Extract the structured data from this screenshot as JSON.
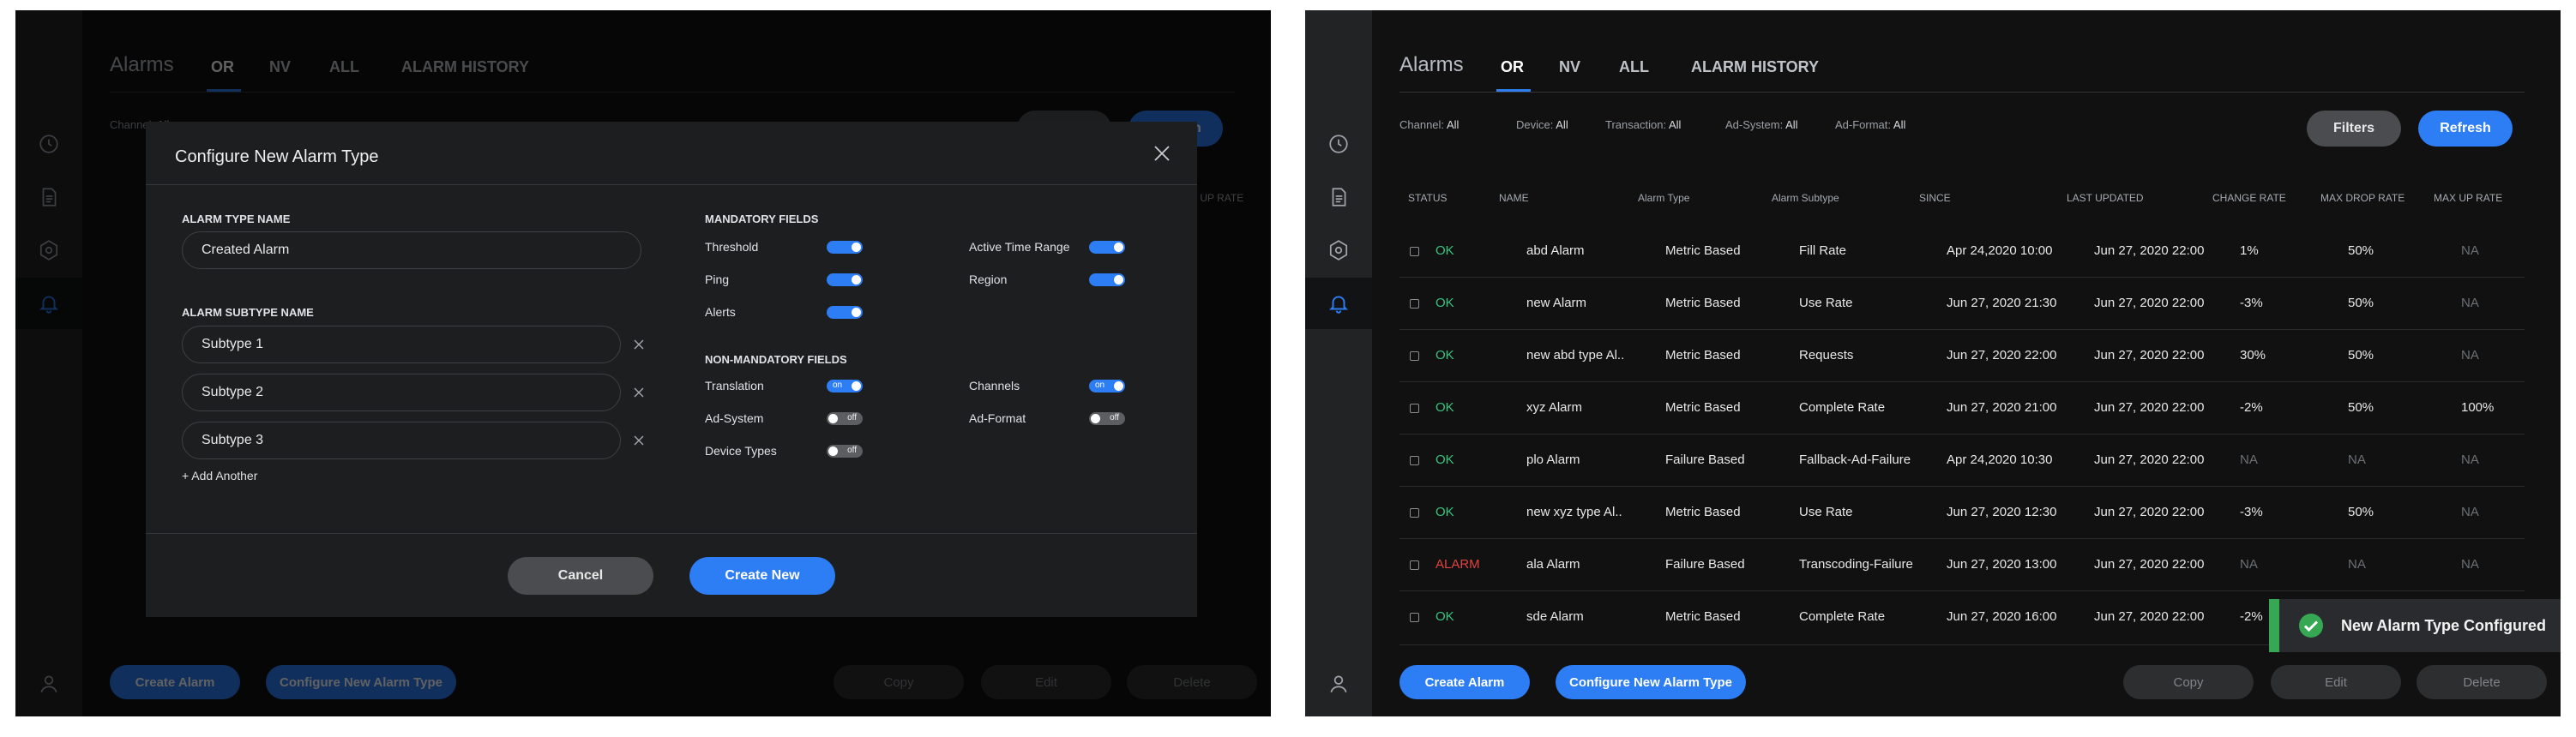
{
  "app": {
    "title": "Alarms",
    "tabs": [
      "OR",
      "NV",
      "ALL",
      "ALARM HISTORY"
    ]
  },
  "filters": [
    {
      "label": "Channel:",
      "value": "All"
    },
    {
      "label": "Device:",
      "value": "All"
    },
    {
      "label": "Transaction:",
      "value": "All"
    },
    {
      "label": "Ad-System:",
      "value": "All"
    },
    {
      "label": "Ad-Format:",
      "value": "All"
    }
  ],
  "toolbar": {
    "filters_label": "Filters",
    "refresh_label": "Refresh"
  },
  "table": {
    "headers": [
      "STATUS",
      "NAME",
      "Alarm Type",
      "Alarm Subtype",
      "SINCE",
      "LAST UPDATED",
      "CHANGE RATE",
      "MAX DROP RATE",
      "MAX UP RATE"
    ],
    "rows": [
      {
        "status": "OK",
        "name": "abd Alarm",
        "type": "Metric Based",
        "subtype": "Fill Rate",
        "since": "Apr 24,2020 10:00",
        "updated": "Jun 27, 2020 22:00",
        "change": "1%",
        "drop": "50%",
        "up": "NA"
      },
      {
        "status": "OK",
        "name": "new Alarm",
        "type": "Metric Based",
        "subtype": "Use Rate",
        "since": "Jun 27, 2020 21:30",
        "updated": "Jun 27, 2020 22:00",
        "change": "-3%",
        "drop": "50%",
        "up": "NA"
      },
      {
        "status": "OK",
        "name": "new abd type Al..",
        "type": "Metric Based",
        "subtype": "Requests",
        "since": "Jun 27, 2020 22:00",
        "updated": "Jun 27, 2020 22:00",
        "change": "30%",
        "drop": "50%",
        "up": "NA"
      },
      {
        "status": "OK",
        "name": "xyz Alarm",
        "type": "Metric Based",
        "subtype": "Complete Rate",
        "since": "Jun 27, 2020 21:00",
        "updated": "Jun 27, 2020 22:00",
        "change": "-2%",
        "drop": "50%",
        "up": "100%"
      },
      {
        "status": "OK",
        "name": "plo Alarm",
        "type": "Failure Based",
        "subtype": "Fallback-Ad-Failure",
        "since": "Apr 24,2020 10:30",
        "updated": "Jun 27, 2020 22:00",
        "change": "NA",
        "drop": "NA",
        "up": "NA"
      },
      {
        "status": "OK",
        "name": "new xyz type Al..",
        "type": "Metric Based",
        "subtype": "Use Rate",
        "since": "Jun 27, 2020 12:30",
        "updated": "Jun 27, 2020 22:00",
        "change": "-3%",
        "drop": "50%",
        "up": "NA"
      },
      {
        "status": "ALARM",
        "name": "ala Alarm",
        "type": "Failure Based",
        "subtype": "Transcoding-Failure",
        "since": "Jun 27, 2020 13:00",
        "updated": "Jun 27, 2020 22:00",
        "change": "NA",
        "drop": "NA",
        "up": "NA"
      },
      {
        "status": "OK",
        "name": "sde Alarm",
        "type": "Metric Based",
        "subtype": "Complete Rate",
        "since": "Jun 27, 2020 16:00",
        "updated": "Jun 27, 2020 22:00",
        "change": "-2%",
        "drop": "",
        "up": ""
      }
    ]
  },
  "footer": {
    "create_alarm": "Create Alarm",
    "configure_type": "Configure New Alarm Type",
    "copy": "Copy",
    "edit": "Edit",
    "delete": "Delete"
  },
  "modal": {
    "title": "Configure New Alarm Type",
    "type_name_label": "ALARM TYPE NAME",
    "type_name_value": "Created Alarm",
    "subtype_label": "ALARM SUBTYPE NAME",
    "subtypes": [
      "Subtype 1",
      "Subtype 2",
      "Subtype 3"
    ],
    "add_another": "+ Add Another",
    "mandatory_label": "MANDATORY FIELDS",
    "mandatory_fields": [
      {
        "label": "Threshold",
        "on": true
      },
      {
        "label": "Active Time Range",
        "on": true
      },
      {
        "label": "Ping",
        "on": true
      },
      {
        "label": "Region",
        "on": true
      },
      {
        "label": "Alerts",
        "on": true
      }
    ],
    "non_mandatory_label": "NON-MANDATORY FIELDS",
    "non_mandatory_fields": [
      {
        "label": "Translation",
        "state": "on"
      },
      {
        "label": "Channels",
        "state": "on"
      },
      {
        "label": "Ad-System",
        "state": "off"
      },
      {
        "label": "Ad-Format",
        "state": "off"
      },
      {
        "label": "Device Types",
        "state": "off"
      }
    ],
    "cancel": "Cancel",
    "create": "Create New"
  },
  "toast": {
    "message": "New Alarm Type Configured"
  },
  "colors": {
    "accent": "#2d7df5",
    "ok": "#39c47f",
    "alarm": "#e0433f",
    "success": "#36a853"
  }
}
